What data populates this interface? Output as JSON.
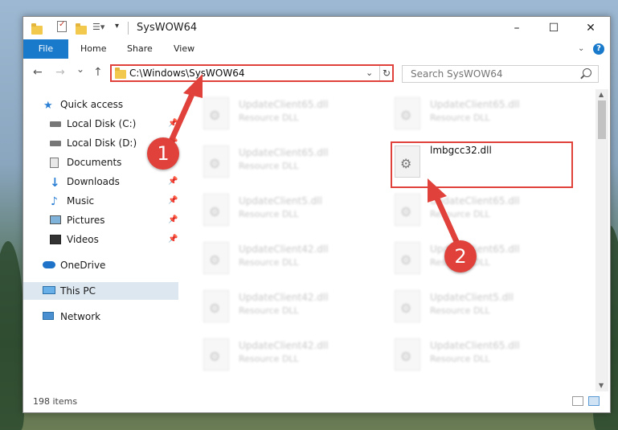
{
  "window": {
    "title": "SysWOW64",
    "minimize": "–",
    "maximize": "☐",
    "close": "✕"
  },
  "ribbon": {
    "tabs": [
      "File",
      "Home",
      "Share",
      "View"
    ],
    "help": "?"
  },
  "nav": {
    "back": "←",
    "forward": "→",
    "recent": "⌄",
    "up": "↑",
    "address": "C:\\Windows\\SysWOW64",
    "search_placeholder": "Search SysWOW64"
  },
  "sidebar": {
    "items": [
      {
        "label": "Quick access",
        "icon": "star-icon"
      },
      {
        "label": "Local Disk (C:)",
        "icon": "drive-icon"
      },
      {
        "label": "Local Disk (D:)",
        "icon": "drive-icon"
      },
      {
        "label": "Documents",
        "icon": "documents-icon"
      },
      {
        "label": "Downloads",
        "icon": "download-icon"
      },
      {
        "label": "Music",
        "icon": "music-icon"
      },
      {
        "label": "Pictures",
        "icon": "pictures-icon"
      },
      {
        "label": "Videos",
        "icon": "videos-icon"
      },
      {
        "label": "OneDrive",
        "icon": "cloud-icon"
      },
      {
        "label": "This PC",
        "icon": "computer-icon"
      },
      {
        "label": "Network",
        "icon": "network-icon"
      }
    ]
  },
  "files": {
    "col1": [
      {
        "name": "UpdateClient65.dll",
        "type": "Resource DLL"
      },
      {
        "name": "UpdateClient65.dll",
        "type": "Resource DLL"
      },
      {
        "name": "UpdateClient5.dll",
        "type": "Resource DLL"
      },
      {
        "name": "UpdateClient42.dll",
        "type": "Resource DLL"
      },
      {
        "name": "UpdateClient42.dll",
        "type": "Resource DLL"
      },
      {
        "name": "UpdateClient42.dll",
        "type": "Resource DLL"
      }
    ],
    "col2": [
      {
        "name": "UpdateClient65.dll",
        "type": "Resource DLL"
      },
      {
        "name": "lmbgcc32.dll",
        "type": ""
      },
      {
        "name": "UpdateClient65.dll",
        "type": "Resource DLL"
      },
      {
        "name": "UpdateClient65.dll",
        "type": "Resource DLL"
      },
      {
        "name": "UpdateClient5.dll",
        "type": "Resource DLL"
      },
      {
        "name": "UpdateClient65.dll",
        "type": "Resource DLL"
      }
    ]
  },
  "status": {
    "items": "198 items"
  },
  "annotations": {
    "badge1": "1",
    "badge2": "2",
    "color": "#e0413a"
  }
}
